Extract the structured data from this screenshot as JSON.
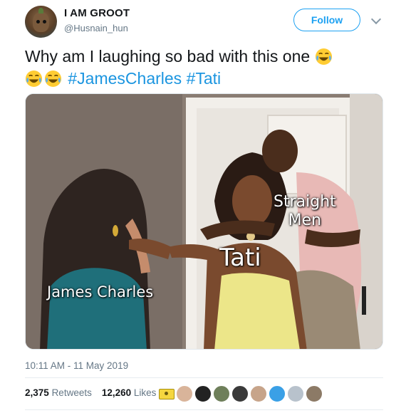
{
  "author": {
    "display_name": "I AM GROOT",
    "handle": "@Husnain_hun",
    "avatar_icon": "groot-avatar-icon"
  },
  "follow_label": "Follow",
  "text": {
    "part1": "Why am I laughing so bad with this one",
    "hashtag1": "#JamesCharles",
    "hashtag2": "#Tati",
    "emoji": "face-with-tears-of-joy-icon"
  },
  "media": {
    "captions": {
      "straight": "Straight",
      "men": "Men",
      "tati": "Tati",
      "james": "James Charles"
    }
  },
  "timestamp": "10:11 AM - 11 May 2019",
  "stats": {
    "retweets_count": "2,375",
    "retweets_label": "Retweets",
    "likes_count": "12,260",
    "likes_label": "Likes"
  },
  "colors": {
    "link": "#1b95e0",
    "follow": "#1da1f2",
    "secondary_text": "#657786"
  }
}
